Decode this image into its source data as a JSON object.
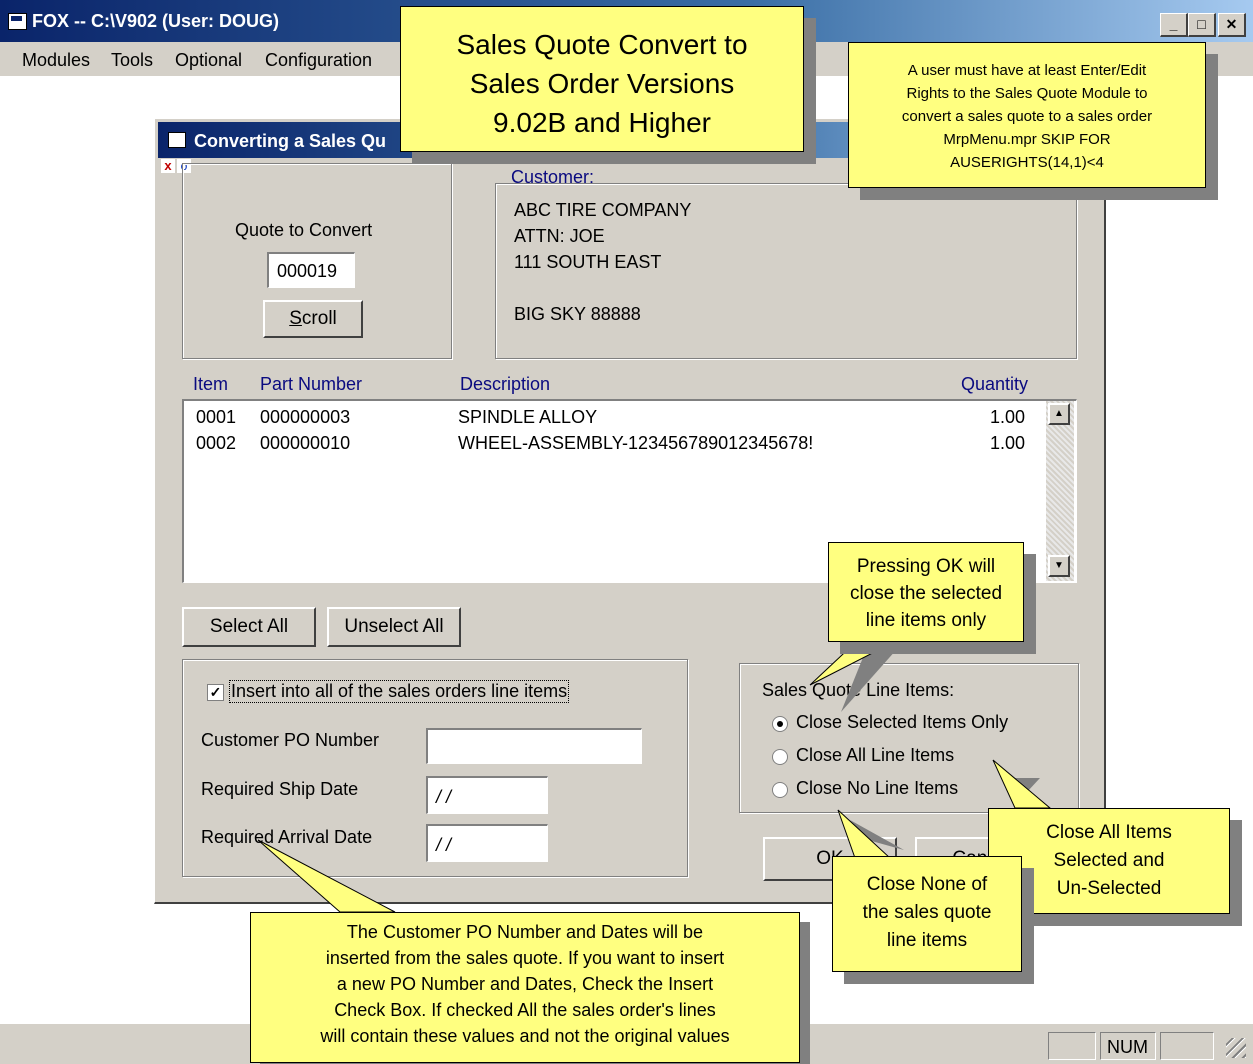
{
  "window": {
    "title": "FOX -- C:\\V902  (User: DOUG)",
    "menu": [
      "Modules",
      "Tools",
      "Optional",
      "Configuration"
    ]
  },
  "status": {
    "num": "NUM"
  },
  "dialog": {
    "title": "Converting a Sales Qu",
    "quote_label": "Quote to Convert",
    "quote_value": "000019",
    "scroll_label": "Scroll",
    "customer_label": "Customer:",
    "customer_lines": [
      "ABC TIRE COMPANY",
      "ATTN: JOE",
      "111 SOUTH EAST",
      "",
      "BIG SKY 88888"
    ],
    "columns": {
      "item": "Item",
      "part": "Part Number",
      "desc": "Description",
      "qty": "Quantity"
    },
    "rows": [
      {
        "item": "0001",
        "part": "000000003",
        "desc": "SPINDLE ALLOY",
        "qty": "1.00"
      },
      {
        "item": "0002",
        "part": "000000010",
        "desc": "WHEEL-ASSEMBLY-123456789012345678!",
        "qty": "1.00"
      }
    ],
    "select_all": "Select All",
    "unselect_all": "Unselect All",
    "insert_label": "Insert into all  of the sales orders line items",
    "insert_checked": true,
    "po_label": "Customer PO Number",
    "ship_label": "Required Ship Date",
    "ship_value": "/ /",
    "arrival_label": "Required Arrival Date",
    "arrival_value": "/ /",
    "sq_group_label": "Sales Quote Line Items:",
    "radios": [
      "Close Selected Items Only",
      "Close All Line Items",
      "Close No Line Items"
    ],
    "radio_selected": 0,
    "ok_label": "OK",
    "cancel_label": "Cancel"
  },
  "callouts": {
    "title": [
      "Sales Quote Convert to",
      "Sales Order Versions",
      "9.02B and Higher"
    ],
    "rights": [
      "A user must have at least Enter/Edit",
      "Rights to the Sales Quote Module to",
      "convert a sales quote to a sales order",
      "MrpMenu.mpr SKIP FOR",
      "AUSERIGHTS(14,1)<4"
    ],
    "pressing_ok": [
      "Pressing OK will",
      "close the selected",
      "line items only"
    ],
    "close_all": [
      "Close All Items",
      "Selected and",
      "Un-Selected"
    ],
    "close_none": [
      "Close None of",
      "the sales quote",
      "line items"
    ],
    "po_dates": [
      "The Customer PO Number and Dates will be",
      "inserted from the sales quote.  If you want to insert",
      "a new PO Number and Dates, Check the Insert",
      "Check Box. If checked All the sales order's lines",
      "will contain these values and not the original values"
    ]
  }
}
